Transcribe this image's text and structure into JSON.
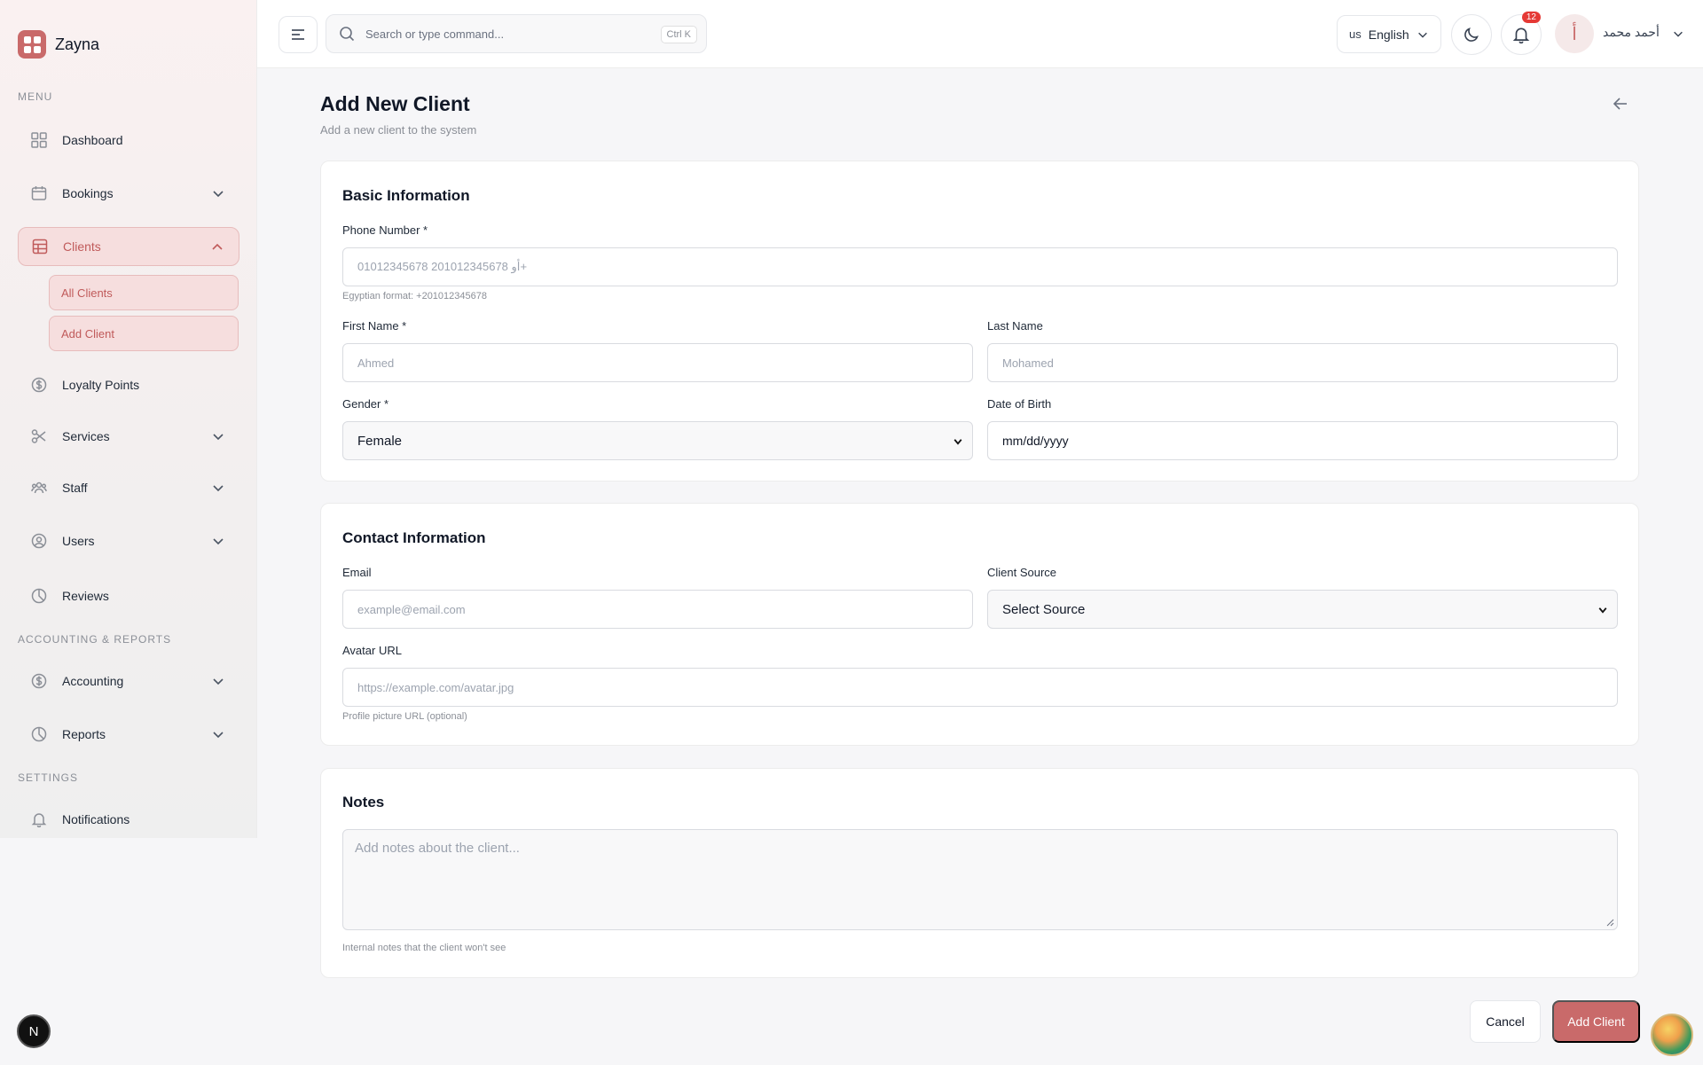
{
  "brand": {
    "name": "Zayna",
    "accent": "#c96a6a"
  },
  "sidebar": {
    "menu_label": "Menu",
    "accounting_label": "Accounting & Reports",
    "settings_label": "Settings",
    "items": [
      {
        "label": "Dashboard",
        "icon": "grid-icon"
      },
      {
        "label": "Bookings",
        "icon": "calendar-icon"
      },
      {
        "label": "Clients",
        "icon": "table-icon"
      },
      {
        "label": "Loyalty Points",
        "icon": "dollar-circle-icon"
      },
      {
        "label": "Services",
        "icon": "scissors-icon"
      },
      {
        "label": "Staff",
        "icon": "users-group-icon"
      },
      {
        "label": "Users",
        "icon": "user-circle-icon"
      },
      {
        "label": "Reviews",
        "icon": "pie-icon"
      },
      {
        "label": "Accounting",
        "icon": "dollar-circle-icon"
      },
      {
        "label": "Reports",
        "icon": "pie-icon"
      },
      {
        "label": "Notifications",
        "icon": "bell-icon"
      }
    ],
    "clients_sub": [
      {
        "label": "All Clients"
      },
      {
        "label": "Add Client"
      }
    ]
  },
  "topbar": {
    "search_placeholder": "Search or type command...",
    "search_shortcut": "Ctrl K",
    "language_code": "us",
    "language": "English",
    "notifications_count": "12",
    "avatar_letter": "أ",
    "user_name": "أحمد محمد"
  },
  "page": {
    "title": "Add New Client",
    "subtitle": "Add a new client to the system"
  },
  "basic": {
    "title": "Basic Information",
    "phone_label": "Phone Number *",
    "phone_placeholder": "01012345678 أو 201012345678+",
    "phone_hint": "Egyptian format: +201012345678",
    "first_name_label": "First Name *",
    "first_name_placeholder": "Ahmed",
    "last_name_label": "Last Name",
    "last_name_placeholder": "Mohamed",
    "gender_label": "Gender *",
    "gender_value": "Female",
    "dob_label": "Date of Birth",
    "dob_value": "mm/dd/yyyy"
  },
  "contact": {
    "title": "Contact Information",
    "email_label": "Email",
    "email_placeholder": "example@email.com",
    "source_label": "Client Source",
    "source_value": "Select Source",
    "avatar_label": "Avatar URL",
    "avatar_placeholder": "https://example.com/avatar.jpg",
    "avatar_hint": "Profile picture URL (optional)"
  },
  "notes": {
    "title": "Notes",
    "placeholder": "Add notes about the client...",
    "hint": "Internal notes that the client won't see"
  },
  "actions": {
    "cancel": "Cancel",
    "submit": "Add Client"
  },
  "misc": {
    "dev_badge": "N"
  }
}
